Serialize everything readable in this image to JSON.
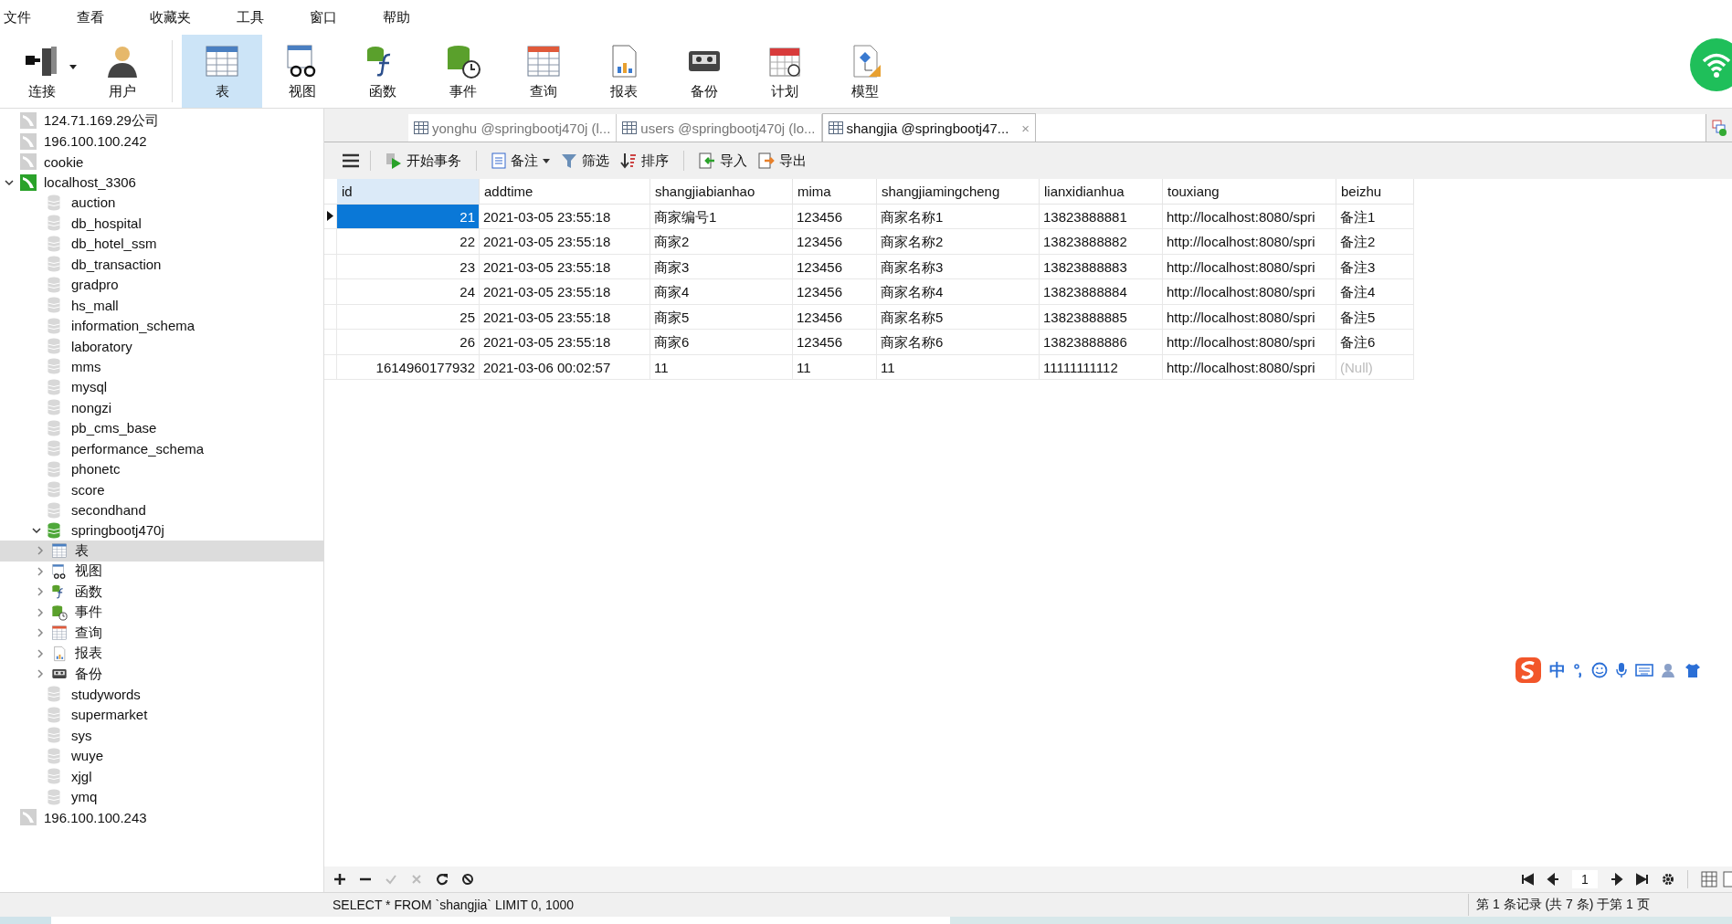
{
  "menu": [
    "文件",
    "查看",
    "收藏夹",
    "工具",
    "窗口",
    "帮助"
  ],
  "toolbar": [
    {
      "label": "连接",
      "kind": "connect",
      "selected": false
    },
    {
      "label": "用户",
      "kind": "user",
      "selected": false
    },
    {
      "label": "表",
      "kind": "table",
      "selected": true
    },
    {
      "label": "视图",
      "kind": "view",
      "selected": false
    },
    {
      "label": "函数",
      "kind": "function",
      "selected": false
    },
    {
      "label": "事件",
      "kind": "event",
      "selected": false
    },
    {
      "label": "查询",
      "kind": "query",
      "selected": false
    },
    {
      "label": "报表",
      "kind": "report",
      "selected": false
    },
    {
      "label": "备份",
      "kind": "backup",
      "selected": false
    },
    {
      "label": "计划",
      "kind": "schedule",
      "selected": false
    },
    {
      "label": "模型",
      "kind": "model",
      "selected": false
    }
  ],
  "sidebar": {
    "tree": [
      {
        "label": "124.71.169.29公司",
        "kind": "server",
        "connected": false
      },
      {
        "label": "196.100.100.242",
        "kind": "server",
        "connected": false
      },
      {
        "label": "cookie",
        "kind": "server",
        "connected": false
      },
      {
        "label": "localhost_3306",
        "kind": "server",
        "connected": true,
        "expanded": true,
        "children": [
          {
            "label": "auction",
            "kind": "database",
            "open": false
          },
          {
            "label": "db_hospital",
            "kind": "database",
            "open": false
          },
          {
            "label": "db_hotel_ssm",
            "kind": "database",
            "open": false
          },
          {
            "label": "db_transaction",
            "kind": "database",
            "open": false
          },
          {
            "label": "gradpro",
            "kind": "database",
            "open": false
          },
          {
            "label": "hs_mall",
            "kind": "database",
            "open": false
          },
          {
            "label": "information_schema",
            "kind": "database",
            "open": false
          },
          {
            "label": "laboratory",
            "kind": "database",
            "open": false
          },
          {
            "label": "mms",
            "kind": "database",
            "open": false
          },
          {
            "label": "mysql",
            "kind": "database",
            "open": false
          },
          {
            "label": "nongzi",
            "kind": "database",
            "open": false
          },
          {
            "label": "pb_cms_base",
            "kind": "database",
            "open": false
          },
          {
            "label": "performance_schema",
            "kind": "database",
            "open": false
          },
          {
            "label": "phonetc",
            "kind": "database",
            "open": false
          },
          {
            "label": "score",
            "kind": "database",
            "open": false
          },
          {
            "label": "secondhand",
            "kind": "database",
            "open": false
          },
          {
            "label": "springbootj470j",
            "kind": "database",
            "open": true,
            "expanded": true,
            "children": [
              {
                "label": "表",
                "kind": "table",
                "expanded": false,
                "selected": true
              },
              {
                "label": "视图",
                "kind": "view",
                "expanded": false,
                "selected": false
              },
              {
                "label": "函数",
                "kind": "function",
                "expanded": false,
                "selected": false
              },
              {
                "label": "事件",
                "kind": "event",
                "expanded": false,
                "selected": false
              },
              {
                "label": "查询",
                "kind": "query",
                "expanded": false,
                "selected": false
              },
              {
                "label": "报表",
                "kind": "report",
                "expanded": false,
                "selected": false
              },
              {
                "label": "备份",
                "kind": "backup",
                "expanded": false,
                "selected": false
              }
            ]
          },
          {
            "label": "studywords",
            "kind": "database",
            "open": false
          },
          {
            "label": "supermarket",
            "kind": "database",
            "open": false
          },
          {
            "label": "sys",
            "kind": "database",
            "open": false
          },
          {
            "label": "wuye",
            "kind": "database",
            "open": false
          },
          {
            "label": "xjgl",
            "kind": "database",
            "open": false
          },
          {
            "label": "ymq",
            "kind": "database",
            "open": false
          }
        ]
      },
      {
        "label": "196.100.100.243",
        "kind": "server",
        "connected": false
      }
    ]
  },
  "tabs": [
    {
      "label": "yonghu @springbootj470j (l...",
      "selected": false
    },
    {
      "label": "users @springbootj470j (lo...",
      "selected": false
    },
    {
      "label": "shangjia @springbootj47...",
      "selected": true,
      "close": "×"
    }
  ],
  "grid_toolbar": [
    {
      "label": "开始事务",
      "kind": "transaction"
    },
    {
      "label": "备注",
      "kind": "memo"
    },
    {
      "label": "筛选",
      "kind": "filter"
    },
    {
      "label": "排序",
      "kind": "sort"
    },
    {
      "label": "导入",
      "kind": "import"
    },
    {
      "label": "导出",
      "kind": "export"
    }
  ],
  "table": {
    "columns": [
      {
        "label": "id",
        "kind": "int",
        "selected": true
      },
      {
        "label": "addtime",
        "kind": "text",
        "selected": false
      },
      {
        "label": "shangjiabianhao",
        "kind": "text",
        "selected": false
      },
      {
        "label": "mima",
        "kind": "text",
        "selected": false
      },
      {
        "label": "shangjiamingcheng",
        "kind": "text",
        "selected": false
      },
      {
        "label": "lianxidianhua",
        "kind": "text",
        "selected": false
      },
      {
        "label": "touxiang",
        "kind": "text",
        "selected": false
      },
      {
        "label": "beizhu",
        "kind": "text",
        "selected": false
      }
    ],
    "rows": [
      {
        "selected": true,
        "cells": [
          "21",
          "2021-03-05 23:55:18",
          "商家编号1",
          "123456",
          "商家名称1",
          "13823888881",
          "http://localhost:8080/spri",
          "备注1"
        ]
      },
      {
        "selected": false,
        "cells": [
          "22",
          "2021-03-05 23:55:18",
          "商家2",
          "123456",
          "商家名称2",
          "13823888882",
          "http://localhost:8080/spri",
          "备注2"
        ]
      },
      {
        "selected": false,
        "cells": [
          "23",
          "2021-03-05 23:55:18",
          "商家3",
          "123456",
          "商家名称3",
          "13823888883",
          "http://localhost:8080/spri",
          "备注3"
        ]
      },
      {
        "selected": false,
        "cells": [
          "24",
          "2021-03-05 23:55:18",
          "商家4",
          "123456",
          "商家名称4",
          "13823888884",
          "http://localhost:8080/spri",
          "备注4"
        ]
      },
      {
        "selected": false,
        "cells": [
          "25",
          "2021-03-05 23:55:18",
          "商家5",
          "123456",
          "商家名称5",
          "13823888885",
          "http://localhost:8080/spri",
          "备注5"
        ]
      },
      {
        "selected": false,
        "cells": [
          "26",
          "2021-03-05 23:55:18",
          "商家6",
          "123456",
          "商家名称6",
          "13823888886",
          "http://localhost:8080/spri",
          "备注6"
        ]
      },
      {
        "selected": false,
        "cells": [
          "1614960177932",
          "2021-03-06 00:02:57",
          "11",
          "11",
          "11",
          "11111111112",
          "http://localhost:8080/spri",
          {
            "text": "(Null)",
            "null": true
          }
        ]
      }
    ]
  },
  "pager": {
    "page": "1"
  },
  "status_bar": {
    "sql": "SELECT * FROM `shangjia` LIMIT 0, 1000",
    "records": "第 1 条记录 (共 7 条) 于第 1 页"
  },
  "ime_bar": {
    "mode": "中"
  }
}
